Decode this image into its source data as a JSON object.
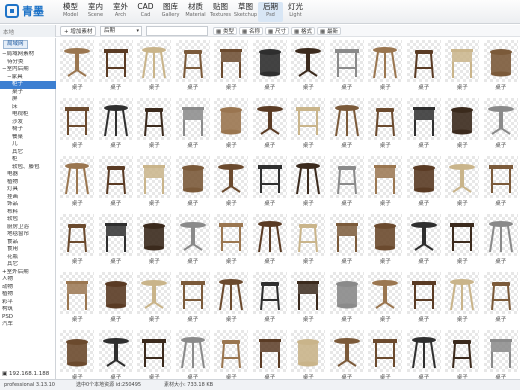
{
  "app": {
    "logo_text": "青墨"
  },
  "nav": {
    "tabs": [
      {
        "zh": "模型",
        "en": "Model"
      },
      {
        "zh": "室内",
        "en": "Scene"
      },
      {
        "zh": "室外",
        "en": "Arch"
      },
      {
        "zh": "CAD",
        "en": "Cad"
      },
      {
        "zh": "图库",
        "en": "Gallery"
      },
      {
        "zh": "材质",
        "en": "Material"
      },
      {
        "zh": "贴图",
        "en": "Textures"
      },
      {
        "zh": "草图",
        "en": "Sketchup"
      },
      {
        "zh": "后期",
        "en": "Psd"
      },
      {
        "zh": "灯光",
        "en": "Light"
      }
    ],
    "active_index": 8
  },
  "toolbar": {
    "sidebar_title": "本地",
    "add_material": "增加素材",
    "category_value": "后期",
    "filters": [
      "类型",
      "名称",
      "尺寸",
      "格式",
      "最新"
    ]
  },
  "sidebar": {
    "tab_label": "局域网",
    "tree": [
      {
        "label": "局域网素材",
        "indent": 0,
        "toggle": "−"
      },
      {
        "label": "待分类",
        "indent": 1,
        "toggle": ""
      },
      {
        "label": "室内后期",
        "indent": 0,
        "toggle": "−"
      },
      {
        "label": "家具",
        "indent": 1,
        "toggle": "−"
      },
      {
        "label": "柜子",
        "indent": 2,
        "toggle": "",
        "selected": true
      },
      {
        "label": "桌子",
        "indent": 2,
        "toggle": ""
      },
      {
        "label": "屏",
        "indent": 2,
        "toggle": ""
      },
      {
        "label": "床",
        "indent": 2,
        "toggle": ""
      },
      {
        "label": "电视柜",
        "indent": 2,
        "toggle": ""
      },
      {
        "label": "沙发",
        "indent": 2,
        "toggle": ""
      },
      {
        "label": "椅子",
        "indent": 2,
        "toggle": ""
      },
      {
        "label": "餐桌",
        "indent": 2,
        "toggle": ""
      },
      {
        "label": "几",
        "indent": 2,
        "toggle": ""
      },
      {
        "label": "其它",
        "indent": 2,
        "toggle": ""
      },
      {
        "label": "柜",
        "indent": 2,
        "toggle": ""
      },
      {
        "label": "软包、藤包",
        "indent": 2,
        "toggle": ""
      },
      {
        "label": "电器",
        "indent": 1,
        "toggle": ""
      },
      {
        "label": "植物",
        "indent": 1,
        "toggle": ""
      },
      {
        "label": "灯具",
        "indent": 1,
        "toggle": ""
      },
      {
        "label": "挂画",
        "indent": 1,
        "toggle": ""
      },
      {
        "label": "饰品",
        "indent": 1,
        "toggle": ""
      },
      {
        "label": "布料",
        "indent": 1,
        "toggle": ""
      },
      {
        "label": "软包",
        "indent": 1,
        "toggle": ""
      },
      {
        "label": "厨房卫浴",
        "indent": 1,
        "toggle": ""
      },
      {
        "label": "地毯窗帘",
        "indent": 1,
        "toggle": ""
      },
      {
        "label": "食品",
        "indent": 1,
        "toggle": ""
      },
      {
        "label": "食用",
        "indent": 1,
        "toggle": ""
      },
      {
        "label": "花瓶",
        "indent": 1,
        "toggle": ""
      },
      {
        "label": "其它",
        "indent": 1,
        "toggle": ""
      },
      {
        "label": "室外后期",
        "indent": 0,
        "toggle": "+"
      },
      {
        "label": "人物",
        "indent": 0,
        "toggle": ""
      },
      {
        "label": "动物",
        "indent": 0,
        "toggle": ""
      },
      {
        "label": "植物",
        "indent": 0,
        "toggle": ""
      },
      {
        "label": "彩平",
        "indent": 0,
        "toggle": ""
      },
      {
        "label": "构筑",
        "indent": 0,
        "toggle": ""
      },
      {
        "label": "PSD",
        "indent": 0,
        "toggle": ""
      },
      {
        "label": "汽车",
        "indent": 0,
        "toggle": ""
      }
    ],
    "server_ip": "192.168.1.188"
  },
  "grid": {
    "item_label": "桌子",
    "item_count": 72,
    "kinds": [
      "round-pedestal",
      "square-table",
      "tripod-table",
      "stool",
      "cabinet-table",
      "drum-table"
    ],
    "colors": [
      "#5a3b24",
      "#3b2a1d",
      "#7b5a3a",
      "#9a7650",
      "#2f2f2f",
      "#c9b48a",
      "#8a8a8a",
      "#6b4a2e"
    ]
  },
  "status": {
    "version": "professional 3.13.10",
    "selection": "选中0个本地资源 id:250495",
    "size": "素材大小: 733.18 KB"
  }
}
